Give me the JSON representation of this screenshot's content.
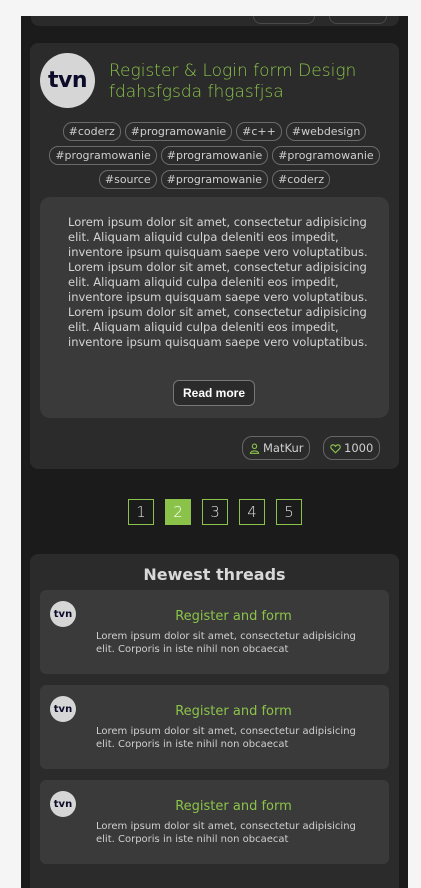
{
  "post": {
    "avatar_text": "tvn",
    "title": "Register & Login form Design fdahsfgsda fhgasfjsa",
    "tags": [
      "#coderz",
      "#programowanie",
      "#c++",
      "#webdesign",
      "#programowanie",
      "#programowanie",
      "#programowanie",
      "#source",
      "#programowanie",
      "#coderz"
    ],
    "body": "Lorem ipsum dolor sit amet, consectetur adipisicing elit. Aliquam aliquid culpa deleniti eos impedit, inventore ipsum quisquam saepe vero voluptatibus. Lorem ipsum dolor sit amet, consectetur adipisicing elit. Aliquam aliquid culpa deleniti eos impedit, inventore ipsum quisquam saepe vero voluptatibus. Lorem ipsum dolor sit amet, consectetur adipisicing elit. Aliquam aliquid culpa deleniti eos impedit, inventore ipsum quisquam saepe vero voluptatibus.",
    "read_more_label": "Read more",
    "author": "MatKur",
    "likes": "1000",
    "author_icon": "user-icon",
    "likes_icon": "heart-icon"
  },
  "pagination": {
    "pages": [
      "1",
      "2",
      "3",
      "4",
      "5"
    ],
    "active_index": 1
  },
  "threads": {
    "title": "Newest threads",
    "items": [
      {
        "avatar_text": "tvn",
        "title": "Register and form",
        "text": "Lorem ipsum dolor sit amet, consectetur adipisicing elit. Corporis in iste nihil non obcaecat"
      },
      {
        "avatar_text": "tvn",
        "title": "Register and form",
        "text": "Lorem ipsum dolor sit amet, consectetur adipisicing elit. Corporis in iste nihil non obcaecat"
      },
      {
        "avatar_text": "tvn",
        "title": "Register and form",
        "text": "Lorem ipsum dolor sit amet, consectetur adipisicing elit. Corporis in iste nihil non obcaecat"
      }
    ]
  },
  "colors": {
    "accent": "#8bc34a",
    "background": "#1b1b1b",
    "card": "#2b2b2b",
    "card_inner": "#3a3a3a"
  }
}
